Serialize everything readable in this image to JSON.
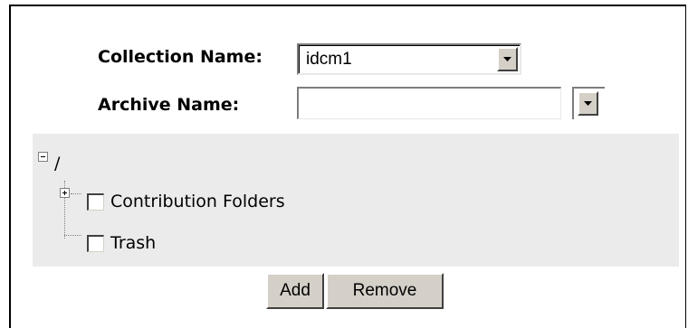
{
  "form": {
    "collection_label": "Collection Name:",
    "collection_value": "idcm1",
    "archive_label": "Archive Name:",
    "archive_value": ""
  },
  "tree": {
    "root_label": "/",
    "items": [
      {
        "label": "Contribution Folders",
        "expandable": true,
        "checked": false
      },
      {
        "label": "Trash",
        "expandable": false,
        "checked": false
      }
    ]
  },
  "actions": {
    "add_label": "Add",
    "remove_label": "Remove"
  },
  "colors": {
    "panel_background": "#ebebeb",
    "button_face": "#d4d0c8"
  }
}
